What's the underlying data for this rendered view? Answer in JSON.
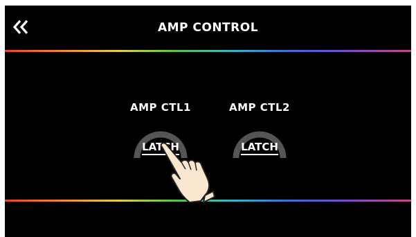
{
  "header": {
    "title": "AMP CONTROL",
    "back_icon": "double-chevron-left-icon"
  },
  "controls": [
    {
      "label": "AMP CTL1",
      "value": "LATCH"
    },
    {
      "label": "AMP CTL2",
      "value": "LATCH"
    }
  ],
  "colors": {
    "background": "#000000",
    "text": "#ffffff",
    "knob_arc": "#555555"
  },
  "overlay": {
    "icon": "pointing-hand-icon"
  }
}
